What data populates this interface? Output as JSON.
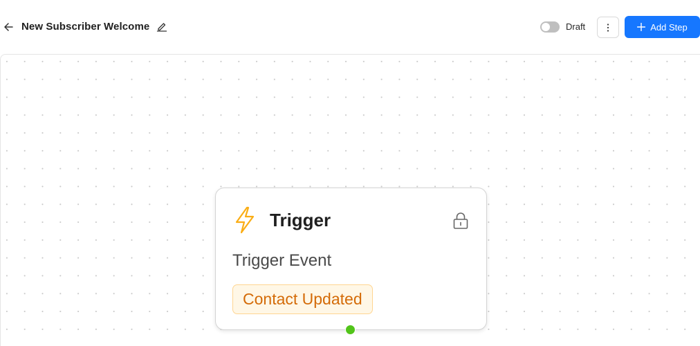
{
  "header": {
    "title": "New Subscriber Welcome",
    "status_label": "Draft",
    "status_enabled": false,
    "add_step_label": "Add Step"
  },
  "icons": {
    "back": "arrow-left-icon",
    "edit": "pencil-icon",
    "more": "vertical-ellipsis-icon",
    "add": "plus-icon",
    "trigger": "lightning-bolt-icon",
    "lock": "lock-icon"
  },
  "colors": {
    "primary": "#1677ff",
    "trigger_icon": "#faad14",
    "badge_text": "#d46b08",
    "badge_bg": "#fff7e6",
    "badge_border": "#ffd591",
    "handle": "#52c41a"
  },
  "node": {
    "title": "Trigger",
    "subtitle": "Trigger Event",
    "event": "Contact Updated"
  }
}
